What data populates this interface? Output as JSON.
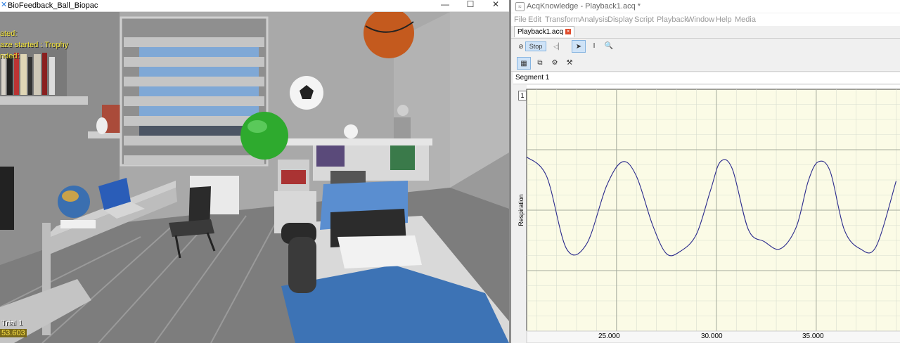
{
  "left_window": {
    "title": "BioFeedback_Ball_Biopac",
    "hud": {
      "line1": "ated:",
      "line2": "aze started : Trophy",
      "line3": "nded:",
      "trial": "Trial 1",
      "timer": "53.603"
    }
  },
  "right_window": {
    "title": "AcqKnowledge - Playback1.acq *",
    "menu": [
      "File",
      "Edit",
      "Transform",
      "Analysis",
      "Display",
      "Script",
      "Playback",
      "Window",
      "Help",
      "Media"
    ],
    "tab": "Playback1.acq",
    "stop_label": "Stop",
    "segment": "Segment 1",
    "channel_number": "1",
    "channel_label": "Respiration",
    "x_ticks": [
      "25.000",
      "30.000",
      "35.000"
    ]
  },
  "colors": {
    "graph_bg": "#fbfbe6",
    "trace": "#2a2a8c",
    "hud_text": "#f1e23a",
    "ball": "#2eaa2e"
  },
  "chart_data": {
    "type": "line",
    "title": "",
    "xlabel": "",
    "ylabel": "Respiration",
    "x_ticks": [
      25,
      30,
      35
    ],
    "xlim": [
      20.5,
      39.3
    ],
    "ylim": [
      0,
      1
    ],
    "grid": true,
    "series": [
      {
        "name": "Respiration",
        "x": [
          20.5,
          21.5,
          22.5,
          23.5,
          24.5,
          25.3,
          26.0,
          26.8,
          27.5,
          28.2,
          29.0,
          29.7,
          30.2,
          30.8,
          31.6,
          32.4,
          33.2,
          34.0,
          34.6,
          35.1,
          35.7,
          36.4,
          37.2,
          38.0,
          39.0
        ],
        "y": [
          0.72,
          0.64,
          0.34,
          0.36,
          0.6,
          0.7,
          0.64,
          0.44,
          0.32,
          0.33,
          0.4,
          0.58,
          0.7,
          0.67,
          0.42,
          0.37,
          0.34,
          0.43,
          0.62,
          0.7,
          0.66,
          0.42,
          0.34,
          0.35,
          0.62
        ]
      }
    ]
  }
}
